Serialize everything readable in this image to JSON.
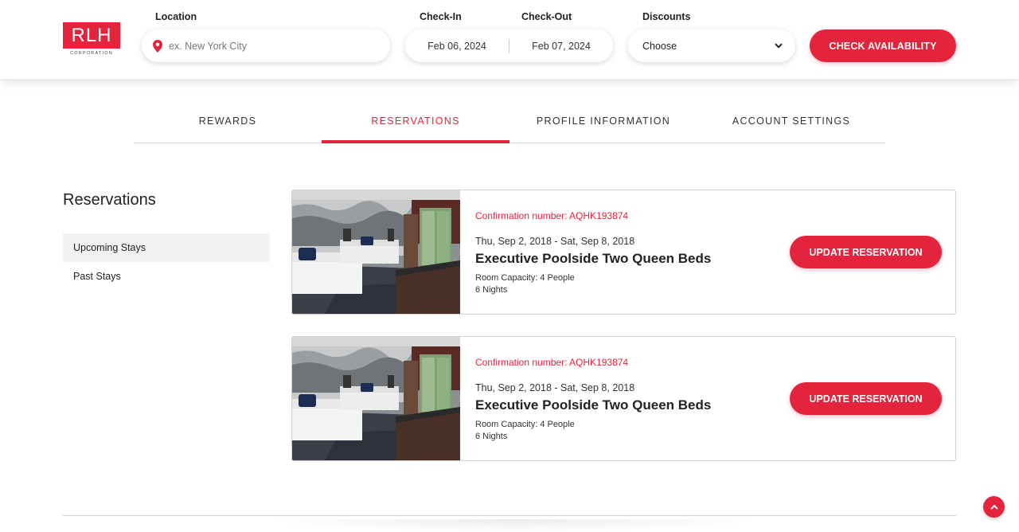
{
  "brand": {
    "logo_text": "RLH",
    "logo_subtext": "CORPORATION",
    "accent_color": "#e4233c"
  },
  "search": {
    "location_label": "Location",
    "location_placeholder": "ex. New York City",
    "checkin_label": "Check-In",
    "checkin_value": "Feb 06, 2024",
    "checkout_label": "Check-Out",
    "checkout_value": "Feb 07, 2024",
    "discounts_label": "Discounts",
    "discounts_value": "Choose",
    "check_button": "CHECK AVAILABILITY"
  },
  "tabs": [
    {
      "label": "REWARDS",
      "active": false
    },
    {
      "label": "RESERVATIONS",
      "active": true
    },
    {
      "label": "PROFILE INFORMATION",
      "active": false
    },
    {
      "label": "ACCOUNT SETTINGS",
      "active": false
    }
  ],
  "sidebar": {
    "title": "Reservations",
    "items": [
      {
        "label": "Upcoming Stays",
        "active": true
      },
      {
        "label": "Past Stays",
        "active": false
      }
    ]
  },
  "reservations": [
    {
      "confirmation": "Confirmation number: AQHK193874",
      "dates": "Thu, Sep 2, 2018 - Sat, Sep 8, 2018",
      "room": "Executive Poolside Two Queen Beds",
      "capacity": "Room Capacity: 4 People",
      "nights": "6 Nights",
      "button": "UPDATE RESERVATION"
    },
    {
      "confirmation": "Confirmation number: AQHK193874",
      "dates": "Thu, Sep 2, 2018 - Sat, Sep 8, 2018",
      "room": "Executive Poolside Two Queen Beds",
      "capacity": "Room Capacity: 4 People",
      "nights": "6 Nights",
      "button": "UPDATE RESERVATION"
    }
  ],
  "icons": {
    "location": "map-pin-icon",
    "discounts_toggle": "chevron-down-icon",
    "scroll_top": "chevron-up-icon"
  }
}
